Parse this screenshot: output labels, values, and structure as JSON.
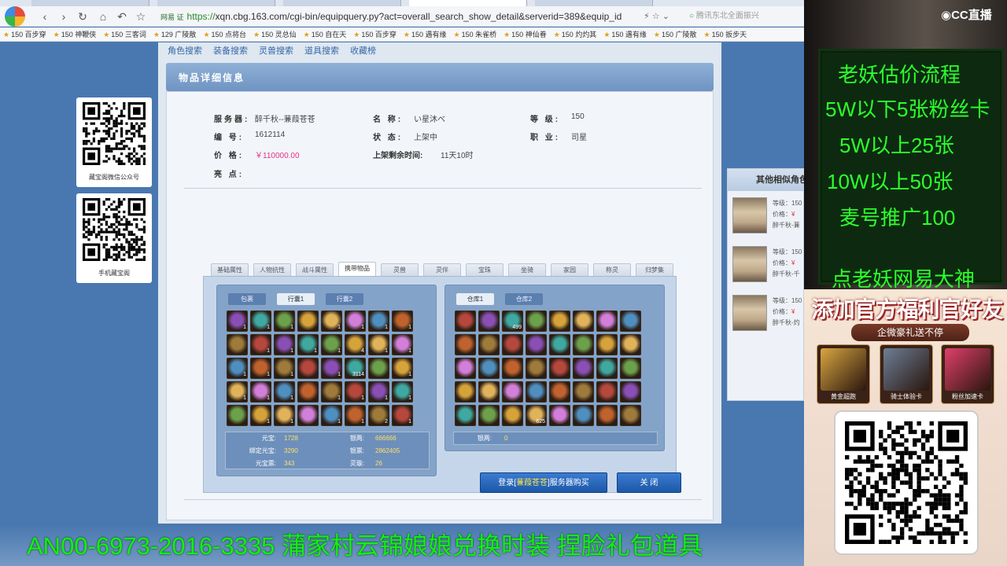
{
  "browser": {
    "address": {
      "brand_tag": "网易 证",
      "scheme": "https://",
      "url_rest": "xqn.cbg.163.com/cgi-bin/equipquery.py?act=overall_search_show_detail&serverid=389&equip_id"
    },
    "search_placeholder": "腾讯东北全面振兴",
    "bookmarks": [
      "150 百步穿",
      "150 神鞭侠",
      "150 三客词",
      "129 广陵散",
      "150 点将台",
      "150 灵总仙",
      "150 自在天",
      "150 百步穿",
      "150 遇有缘",
      "150 朱雀桥",
      "150 神仙眷",
      "150 灼灼其",
      "150 遇有缘",
      "150 广陵散",
      "150 扳步天"
    ]
  },
  "site": {
    "topnav": [
      "角色搜索",
      "装备搜索",
      "灵兽搜索",
      "道具搜索",
      "收藏榜"
    ],
    "detail_title": "物品详细信息",
    "fields": {
      "server_label": "服务器:",
      "server_value": "醉千秋--蒹葭苍苍",
      "name_label": "名 称:",
      "name_value": "い星沐べ",
      "level_label": "等 级:",
      "level_value": "150",
      "id_label": "编 号:",
      "id_value": "1612114",
      "status_label": "状 态:",
      "status_value": "上架中",
      "job_label": "职 业:",
      "job_value": "司星",
      "price_label": "价 格:",
      "price_value": "￥110000.00",
      "remain_label": "上架剩余时间:",
      "remain_value": "11天10时",
      "highlight_label": "亮 点:"
    },
    "tabs": [
      "基础属性",
      "人物抗性",
      "战斗属性",
      "携带物品",
      "灵兽",
      "灵伴",
      "宝珠",
      "坐骑",
      "家园",
      "称灵",
      "归梦集"
    ],
    "active_tab": 3,
    "bag": {
      "subtabs": [
        "包裹",
        "行囊1",
        "行囊2"
      ],
      "active_subtab": 1,
      "counts": [
        "1",
        "1",
        "1",
        "",
        "1",
        "1",
        "1",
        "1",
        "",
        "1",
        "1",
        "1",
        "1",
        "4",
        "1",
        "1",
        "1",
        "1",
        "1",
        "",
        "1",
        "3114",
        "",
        "1",
        "1",
        "1",
        "1",
        "",
        "1",
        "1",
        "1",
        "1",
        "",
        "1",
        "1",
        "",
        "1",
        "1",
        "2",
        "1"
      ],
      "stats": [
        {
          "k": "元宝:",
          "v": "1728",
          "k2": "银两:",
          "v2": "666666"
        },
        {
          "k": "绑定元宝:",
          "v": "3290",
          "k2": "银票:",
          "v2": "2862405"
        },
        {
          "k": "元宝票:",
          "v": "343",
          "k2": "灵璇:",
          "v2": "26"
        }
      ]
    },
    "warehouse": {
      "subtabs": [
        "仓库1",
        "仓库2"
      ],
      "active_subtab": 0,
      "counts": [
        "",
        "",
        "499",
        "",
        "",
        "",
        "",
        "",
        "",
        "",
        "",
        "",
        "",
        "",
        "",
        "",
        "",
        "",
        "",
        "",
        "",
        "",
        "",
        "",
        "",
        "",
        "",
        "",
        "",
        "",
        "",
        "",
        "",
        "",
        "",
        "625",
        "",
        "",
        "",
        ""
      ],
      "stats": [
        {
          "k": "银两:",
          "v": "0"
        }
      ]
    },
    "buy_button": {
      "pre": "登录[",
      "server": "蒹葭苍苍",
      "post": "]服务器购买"
    },
    "close_button": "关 闭",
    "similar": {
      "title": "其他相似角色",
      "items": [
        {
          "level": "等级：150",
          "price_label": "价格：",
          "price": "¥",
          "server": "醉千秋-蒹"
        },
        {
          "level": "等级：150",
          "price_label": "价格：",
          "price": "¥",
          "server": "醉千秋-千"
        },
        {
          "level": "等级：150",
          "price_label": "价格：",
          "price": "¥",
          "server": "醉千秋-灼"
        }
      ]
    },
    "qr_cards": [
      {
        "caption": "藏宝阁微信公众号"
      },
      {
        "caption": "手机藏宝阁"
      }
    ]
  },
  "overlay": {
    "ticker": "AN00-6973-2016-3335 蒲家村云锦娘娘兑换时装 捏脸礼包道具",
    "cc_logo": "CC直播",
    "green_lines": [
      "老妖估价流程",
      "5W以下5张粉丝卡",
      "5W以上25张",
      "10W以上50张",
      "麦号推广100",
      "点老妖网易大神"
    ],
    "promo_title": "添加官方福利官好友",
    "promo_sub": "企微豪礼送不停",
    "gifts": [
      {
        "label": "黄金超跑",
        "color": "#d9a640"
      },
      {
        "label": "骑士体验卡",
        "color": "#6c7f96"
      },
      {
        "label": "粉丝加速卡",
        "color": "#e0406a"
      }
    ]
  },
  "colors": {
    "accent": "#4978b0",
    "price": "#e6318a",
    "ticker": "#11f211"
  }
}
